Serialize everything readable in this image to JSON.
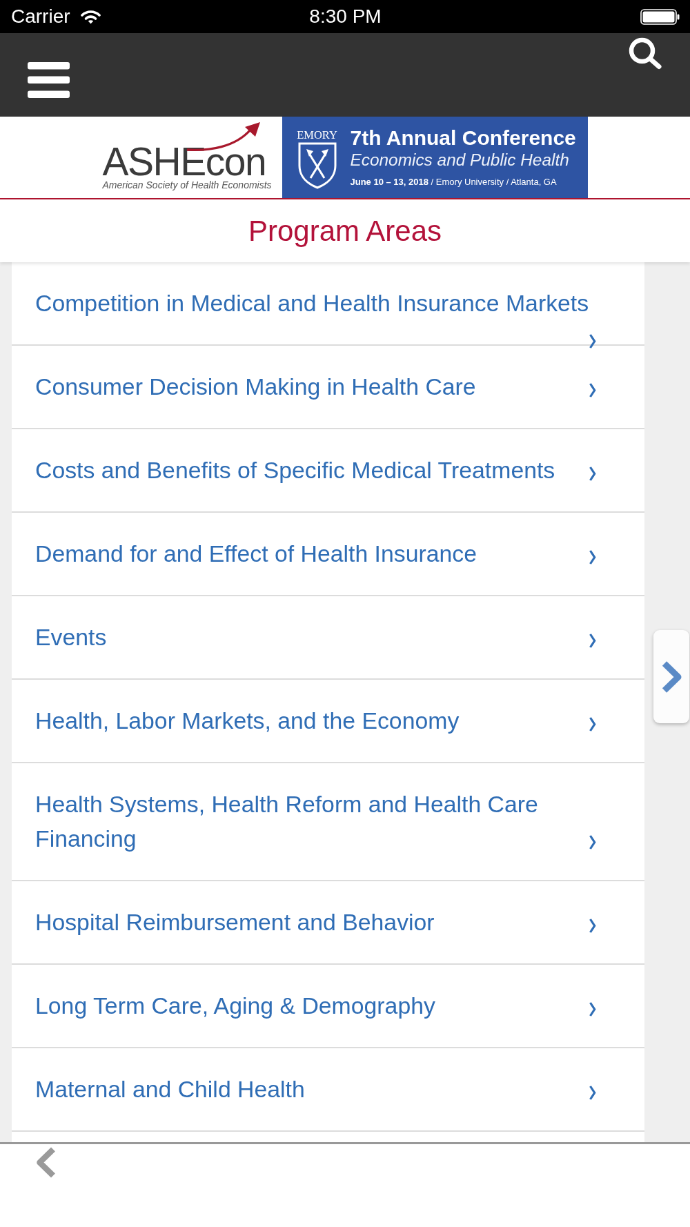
{
  "status_bar": {
    "carrier": "Carrier",
    "time": "8:30 PM"
  },
  "banner": {
    "logo_name": "ASHEcon",
    "logo_tagline": "American Society of Health Economists",
    "university": "EMORY",
    "title": "7th Annual Conference",
    "theme": "Economics and Public Health",
    "details": "**June 10 – 13, 2018** / Emory University / Atlanta, GA"
  },
  "page_title": "Program Areas",
  "program_areas": [
    {
      "label": "Competition in Medical and Health Insurance Markets"
    },
    {
      "label": "Consumer Decision Making in Health Care"
    },
    {
      "label": "Costs and Benefits of Specific Medical Treatments"
    },
    {
      "label": "Demand for and Effect of Health Insurance"
    },
    {
      "label": "Events"
    },
    {
      "label": "Health, Labor Markets, and the Economy"
    },
    {
      "label": "Health Systems, Health Reform and Health Care Financing"
    },
    {
      "label": "Hospital Reimbursement and Behavior"
    },
    {
      "label": "Long Term Care, Aging & Demography"
    },
    {
      "label": "Maternal and Child Health"
    }
  ]
}
